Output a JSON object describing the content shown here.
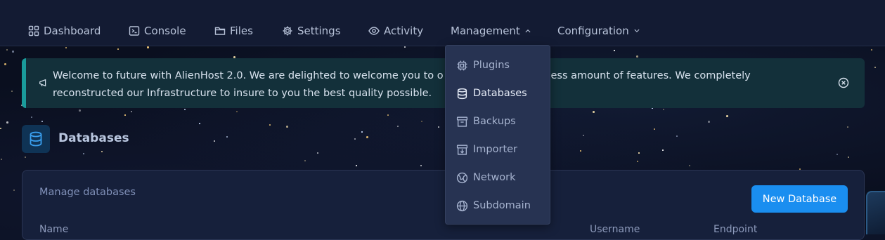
{
  "nav": {
    "items": [
      {
        "label": "Dashboard",
        "icon": "dashboard-grid-icon"
      },
      {
        "label": "Console",
        "icon": "console-icon"
      },
      {
        "label": "Files",
        "icon": "folder-icon"
      },
      {
        "label": "Settings",
        "icon": "gear-icon"
      },
      {
        "label": "Activity",
        "icon": "eye-icon"
      },
      {
        "label": "Management",
        "icon": "chevron-up-icon",
        "expanded": true
      },
      {
        "label": "Configuration",
        "icon": "chevron-down-icon",
        "expanded": false
      }
    ]
  },
  "dropdown": {
    "items": [
      {
        "label": "Plugins",
        "icon": "chip-icon"
      },
      {
        "label": "Databases",
        "icon": "database-icon",
        "active": true
      },
      {
        "label": "Backups",
        "icon": "archive-icon"
      },
      {
        "label": "Importer",
        "icon": "import-box-icon"
      },
      {
        "label": "Network",
        "icon": "network-icon"
      },
      {
        "label": "Subdomain",
        "icon": "globe-icon"
      }
    ]
  },
  "alert": {
    "text": "Welcome to future with AlienHost 2.0. We are delighted to welcome you to o",
    "text_right": "th endless amount of features. We completely",
    "text_line2": "reconstructed our Infrastructure to insure to you the best quality possible."
  },
  "page": {
    "title": "Databases"
  },
  "card": {
    "subtitle": "Manage databases",
    "new_button": "New Database",
    "columns": [
      "Name",
      "Username",
      "Endpoint"
    ]
  },
  "colors": {
    "nav_bg": "#131b33",
    "alert_bg": "#13303a",
    "alert_accent": "#1a9b9b",
    "primary_button": "#1a8ef0",
    "dropdown_bg": "#273352"
  }
}
